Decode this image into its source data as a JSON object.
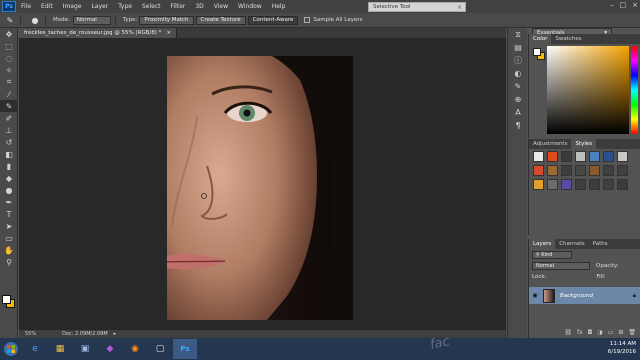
{
  "menubar": {
    "logo": "Ps",
    "items": [
      "File",
      "Edit",
      "Image",
      "Layer",
      "Type",
      "Select",
      "Filter",
      "3D",
      "View",
      "Window",
      "Help"
    ],
    "popup_label": "Selective Tool",
    "popup_close": "×",
    "window_controls": [
      "–",
      "□",
      "×"
    ]
  },
  "options": {
    "mode_label": "Mode:",
    "mode_value": "Normal",
    "type_label": "Type:",
    "type_buttons": [
      "Proximity Match",
      "Create Texture",
      "Content-Aware"
    ],
    "sample_label": "Sample All Layers",
    "workspace": "Essentials"
  },
  "document": {
    "tab_label": "freckles_taches_de_rousseur.jpg @ 55% (RGB/8) *",
    "tab_close": "×",
    "zoom": "55%",
    "doc_info": "Doc: 2.09M/2.09M"
  },
  "color_panel": {
    "tabs": [
      "Color",
      "Swatches"
    ],
    "foreground": "#ffffff",
    "background": "#f0c000"
  },
  "styles_panel": {
    "tabs": [
      "Adjustments",
      "Styles"
    ],
    "swatches": [
      "#e9e9e9",
      "#e14b19",
      "#3a3a3a",
      "#bdbdbd",
      "#4a7fc2",
      "#2a4f8c",
      "#c8c8c8",
      "#d44a2a",
      "#9c6a2c",
      "#3e3e3e",
      "#484848",
      "#8a5a2a",
      "#3f3f3f",
      "#404040",
      "#e0a12b",
      "#6b6b6b",
      "#5b4aa8",
      "#404040",
      "#3d3d3d",
      "#3f3f3f",
      "#3b3b3b"
    ]
  },
  "layers_panel": {
    "tabs": [
      "Layers",
      "Channels",
      "Paths"
    ],
    "filter": "Kind",
    "blend": "Normal",
    "opacity_label": "Opacity:",
    "fill_label": "Fill:",
    "lock_label": "Lock:",
    "layer_name": "Background"
  },
  "taskbar": {
    "time": "11:14 AM",
    "date": "6/19/2016",
    "apps": [
      "e",
      "▦",
      "▣",
      "◆",
      "◉",
      "▢",
      "Ps"
    ]
  },
  "watermark": "fac"
}
